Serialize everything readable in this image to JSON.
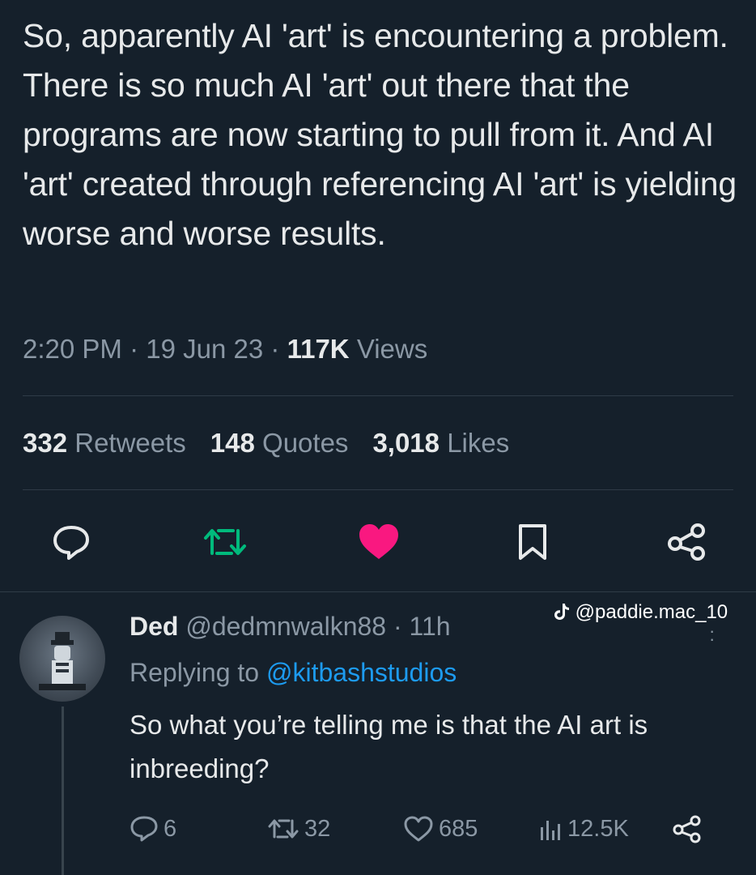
{
  "main_tweet": {
    "text": "So, apparently AI 'art' is encountering a problem.  There is so much AI 'art' out there that the programs are now starting to pull from it.  And AI 'art' created through referencing AI 'art' is yielding worse and worse results.",
    "time": "2:20 PM",
    "date": "19 Jun 23",
    "views_count": "117K",
    "views_label": "Views",
    "separator": "·"
  },
  "stats": {
    "retweets_count": "332",
    "retweets_label": "Retweets",
    "quotes_count": "148",
    "quotes_label": "Quotes",
    "likes_count": "3,018",
    "likes_label": "Likes"
  },
  "actions": {
    "icons": [
      "reply-icon",
      "retweet-icon",
      "like-icon",
      "bookmark-icon",
      "share-icon"
    ],
    "retweet_color": "#00ba7c",
    "like_color": "#f91880"
  },
  "watermark": {
    "icon": "tiktok-icon",
    "handle": "@paddie.mac_10"
  },
  "reply": {
    "name": "Ded",
    "handle": "@dedmnwalkn88",
    "time": "11h",
    "separator": "·",
    "replying_label": "Replying to",
    "replying_to": "@kitbashstudios",
    "text": "So what you’re telling me is that the AI art is inbreeding?",
    "replies": "6",
    "retweets": "32",
    "likes": "685",
    "views": "12.5K"
  },
  "colors": {
    "background": "#15202b",
    "text": "#e7e9ea",
    "muted": "#8b98a5",
    "link": "#1d9bf0"
  }
}
